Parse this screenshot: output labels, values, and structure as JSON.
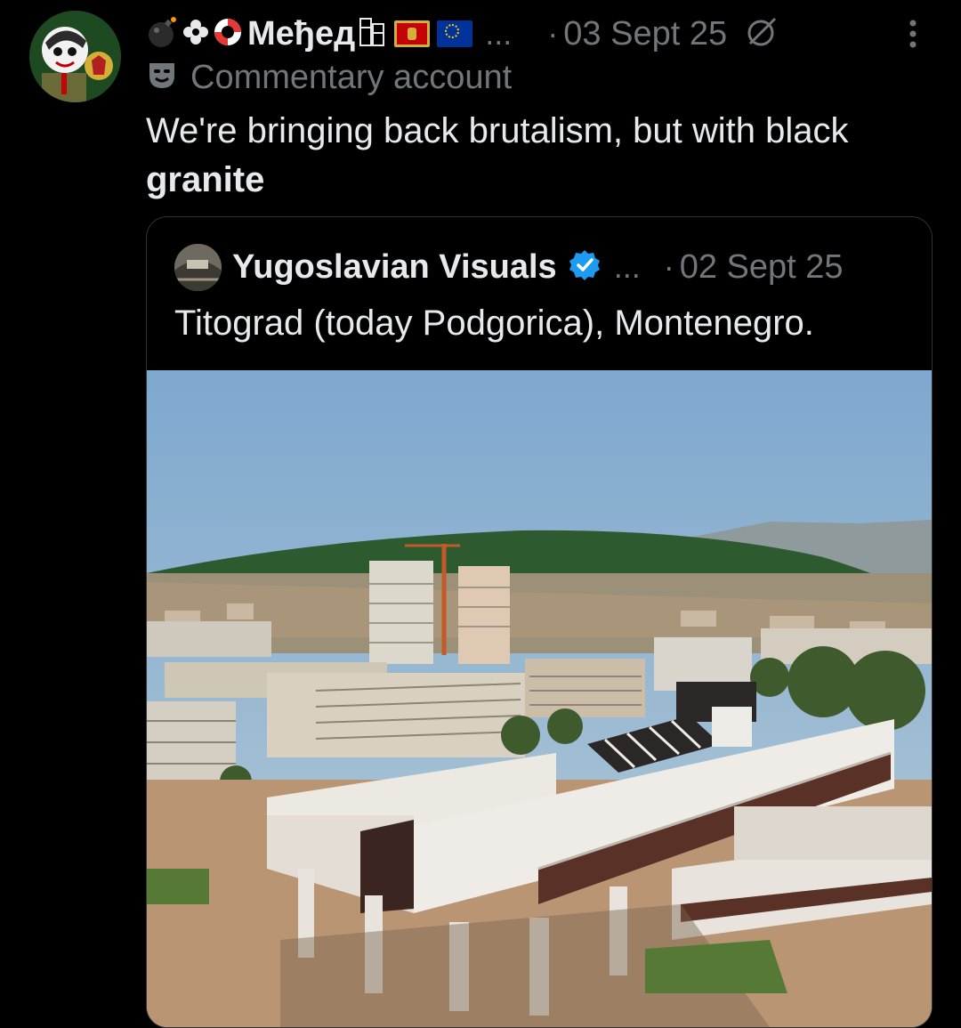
{
  "post": {
    "author_emojis": [
      "💣",
      "✿",
      "🛟"
    ],
    "author_name": "Међед",
    "author_suffix_emoji": "🗼",
    "flags": [
      "montenegro-flag",
      "eu-flag"
    ],
    "truncation": "...",
    "separator": "·",
    "date": "03 Sept 25",
    "subtitle_icon": "theater-mask-icon",
    "subtitle": "Commentary account",
    "text_main": "We're bringing back brutalism, but with black",
    "text_bold": "granite"
  },
  "quote": {
    "author_name": "Yugoslavian Visuals",
    "verified": true,
    "truncation": "...",
    "separator": "·",
    "date": "02 Sept 25",
    "text": "Titograd (today Podgorica), Montenegro.",
    "image_subject": "photo-titograd-brutalist-buildings"
  },
  "colors": {
    "background": "#000000",
    "text_primary": "#e7e9ea",
    "text_secondary": "#71767b",
    "border": "#2f3336",
    "verified_blue": "#1d9bf0"
  }
}
